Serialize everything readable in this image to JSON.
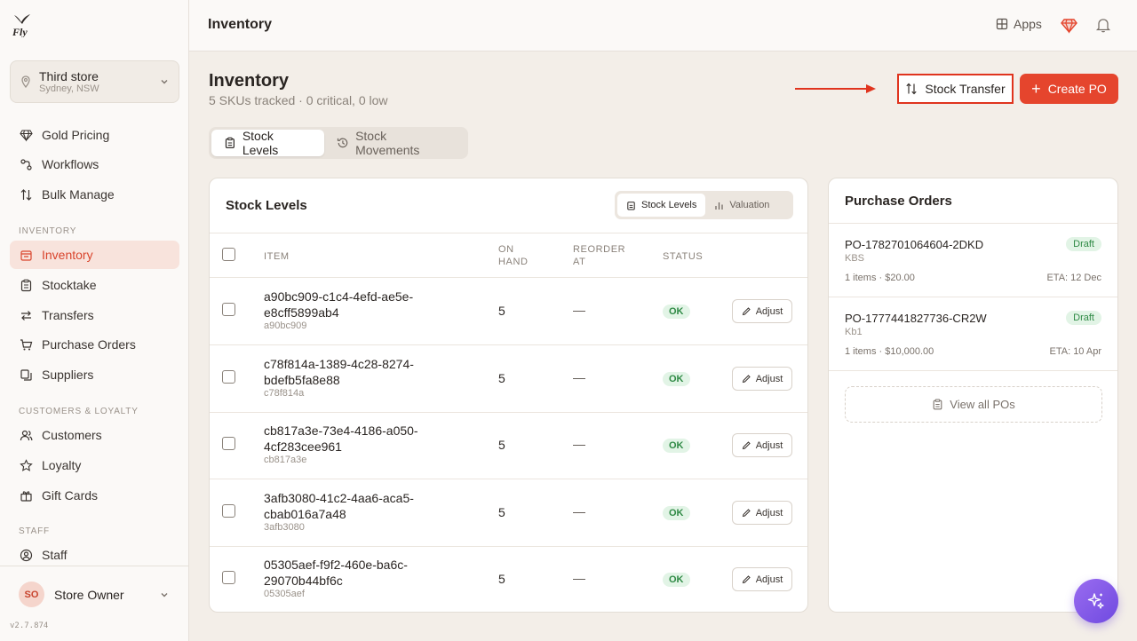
{
  "app": {
    "logo_text": "Fly",
    "version": "v2.7.874"
  },
  "store": {
    "name": "Third store",
    "location": "Sydney, NSW"
  },
  "sidebar": {
    "top_items": [
      {
        "label": "Gold Pricing",
        "icon": "gem-icon"
      },
      {
        "label": "Workflows",
        "icon": "workflow-icon"
      },
      {
        "label": "Bulk Manage",
        "icon": "sort-arrows-icon"
      }
    ],
    "section_inventory": "INVENTORY",
    "inventory_items": [
      {
        "label": "Inventory",
        "icon": "box-icon",
        "active": true
      },
      {
        "label": "Stocktake",
        "icon": "clipboard-icon"
      },
      {
        "label": "Transfers",
        "icon": "transfer-icon"
      },
      {
        "label": "Purchase Orders",
        "icon": "cart-icon"
      },
      {
        "label": "Suppliers",
        "icon": "copy-icon"
      }
    ],
    "section_customers": "CUSTOMERS & LOYALTY",
    "customer_items": [
      {
        "label": "Customers",
        "icon": "users-icon"
      },
      {
        "label": "Loyalty",
        "icon": "star-icon"
      },
      {
        "label": "Gift Cards",
        "icon": "gift-icon"
      }
    ],
    "section_staff": "STAFF",
    "staff_items": [
      {
        "label": "Staff",
        "icon": "user-circle-icon"
      }
    ]
  },
  "user": {
    "initials": "SO",
    "name": "Store Owner"
  },
  "topbar": {
    "title": "Inventory",
    "apps_label": "Apps"
  },
  "page": {
    "title": "Inventory",
    "subtitle": "5 SKUs tracked · 0 critical, 0 low",
    "stock_transfer_label": "Stock Transfer",
    "create_po_label": "Create PO",
    "accent": "#e5452d"
  },
  "tabs": [
    {
      "label": "Stock Levels",
      "active": true
    },
    {
      "label": "Stock Movements",
      "active": false
    }
  ],
  "stock_card": {
    "title": "Stock Levels",
    "segments": [
      "Stock Levels",
      "Valuation"
    ],
    "columns": {
      "item": "ITEM",
      "on_hand_1": "ON",
      "on_hand_2": "HAND",
      "reorder_1": "REORDER",
      "reorder_2": "AT",
      "status": "STATUS"
    },
    "rows": [
      {
        "name": "a90bc909-c1c4-4efd-ae5e-e8cff5899ab4",
        "sku": "a90bc909",
        "on_hand": "5",
        "reorder": "—",
        "status": "OK",
        "action": "Adjust"
      },
      {
        "name": "c78f814a-1389-4c28-8274-bdefb5fa8e88",
        "sku": "c78f814a",
        "on_hand": "5",
        "reorder": "—",
        "status": "OK",
        "action": "Adjust"
      },
      {
        "name": "cb817a3e-73e4-4186-a050-4cf283cee961",
        "sku": "cb817a3e",
        "on_hand": "5",
        "reorder": "—",
        "status": "OK",
        "action": "Adjust"
      },
      {
        "name": "3afb3080-41c2-4aa6-aca5-cbab016a7a48",
        "sku": "3afb3080",
        "on_hand": "5",
        "reorder": "—",
        "status": "OK",
        "action": "Adjust"
      },
      {
        "name": "05305aef-f9f2-460e-ba6c-29070b44bf6c",
        "sku": "05305aef",
        "on_hand": "5",
        "reorder": "—",
        "status": "OK",
        "action": "Adjust"
      }
    ]
  },
  "po_card": {
    "title": "Purchase Orders",
    "orders": [
      {
        "id": "PO-1782701064604-2DKD",
        "vendor": "KBS",
        "status": "Draft",
        "meta": "1 items · $20.00",
        "eta": "ETA: 12 Dec"
      },
      {
        "id": "PO-1777441827736-CR2W",
        "vendor": "Kb1",
        "status": "Draft",
        "meta": "1 items · $10,000.00",
        "eta": "ETA: 10 Apr"
      }
    ],
    "view_all_label": "View all POs"
  }
}
